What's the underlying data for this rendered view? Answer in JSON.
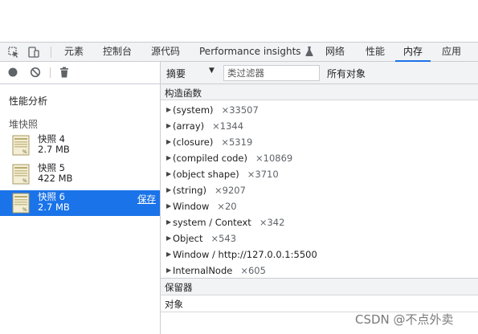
{
  "tabs": {
    "items": [
      "元素",
      "控制台",
      "源代码",
      "Performance insights",
      "网络",
      "性能",
      "内存",
      "应用"
    ],
    "active_index": 6,
    "accent_color": "#1a73e8"
  },
  "sidebar": {
    "performance_label": "性能分析",
    "heap_snapshots_label": "堆快照",
    "snapshots": [
      {
        "name": "快照 4",
        "size": "2.7 MB"
      },
      {
        "name": "快照 5",
        "size": "422 MB"
      },
      {
        "name": "快照 6",
        "size": "2.7 MB",
        "action": "保存"
      }
    ],
    "selected_index": 2
  },
  "main_toolbar": {
    "view": "摘要",
    "filter_placeholder": "类过滤器",
    "objects_filter": "所有对象"
  },
  "table": {
    "column_header": "构造函数",
    "rows": [
      {
        "name": "(system)",
        "count": "×33507"
      },
      {
        "name": "(array)",
        "count": "×1344"
      },
      {
        "name": "(closure)",
        "count": "×5319"
      },
      {
        "name": "(compiled code)",
        "count": "×10869"
      },
      {
        "name": "(object shape)",
        "count": "×3710"
      },
      {
        "name": "(string)",
        "count": "×9207"
      },
      {
        "name": "Window",
        "count": "×20"
      },
      {
        "name": "system / Context",
        "count": "×342"
      },
      {
        "name": "Object",
        "count": "×543"
      },
      {
        "name": "Window / http://127.0.0.1:5500",
        "count": ""
      },
      {
        "name": "InternalNode",
        "count": "×605"
      }
    ]
  },
  "retainers": {
    "header": "保留器",
    "object_column": "对象"
  },
  "watermark": "CSDN @不点外卖"
}
